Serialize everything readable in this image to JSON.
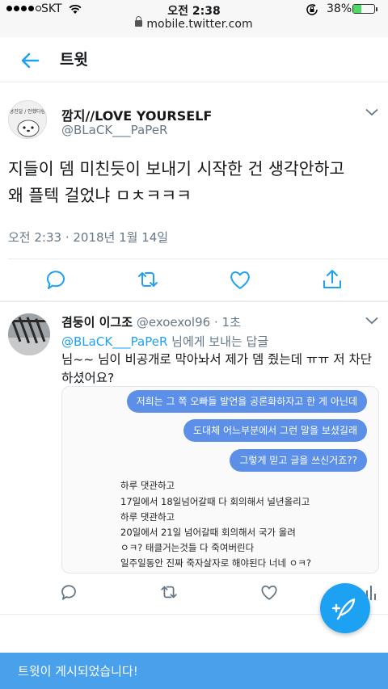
{
  "status_bar": {
    "carrier": "SKT",
    "time": "오전 2:38",
    "url": "mobile.twitter.com",
    "battery_percent": "38%",
    "battery_level": 0.38,
    "icons": [
      "signal-dots",
      "wifi-icon",
      "lock-icon",
      "rotation-lock-icon",
      "battery-icon"
    ]
  },
  "header": {
    "title": "트윗",
    "back_icon": "arrow-left-icon"
  },
  "tweet": {
    "author_name": "깜지//LOVE YOURSELF",
    "author_handle": "@BLaCK___PaPeR",
    "avatar_text": "홍진달 / 안했다람",
    "text_line1": "지들이 뎀 미친듯이 보내기 시작한 건 생각안하고",
    "text_line2": "왜 플텍 걸었냐 ㅁㅊㅋㅋㅋ",
    "date": "오전 2:33 · 2018년 1월 14일",
    "actions": [
      "reply-icon",
      "retweet-icon",
      "like-icon",
      "share-icon"
    ]
  },
  "reply": {
    "author_name": "겸둥이 이그조",
    "author_handle": "@exoexol96",
    "separator": "·",
    "time": "1초",
    "reply_to_mention": "@BLaCK___PaPeR",
    "reply_to_suffix": " 님에게 보내는 답글",
    "text": "님~~ 님이 비공개로 막아놔서 제가 뎀 줬는데 ㅠㅠ 저 차단하셨어요?",
    "photo": {
      "bubbles": [
        "저희는 그 쪽 오빠들 발언을 공론화하자고 한 게 아닌데",
        "도대체 어느부분에서 그런 말을 보셨길래",
        "그렇게 믿고 글을 쓰신거죠??"
      ],
      "lines": [
        "하루 댓관하고",
        "17일에서 18일넘어갈때 다 회의해서 널년올리고",
        "하루 댓관하고",
        "20일에서 21일 넘어갈때 회의해서 국가 올려",
        "ㅇㅋ? 태클거는것들 다 죽여버린다",
        "일주일동안 진짜 죽자살자로 해야된다 너네 ㅇㅋ?"
      ]
    }
  },
  "fab": {
    "icon": "compose-feather-icon"
  },
  "toast": {
    "text": "트윗이 게시되었습니다!"
  }
}
